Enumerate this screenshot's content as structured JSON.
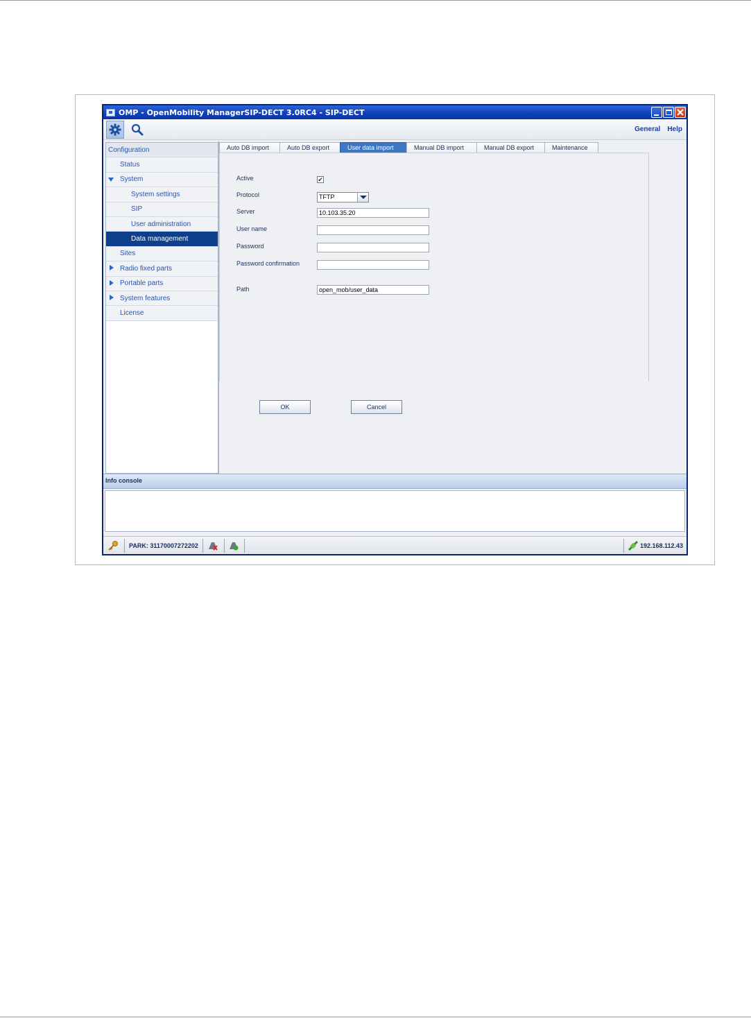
{
  "window": {
    "title": "OMP - OpenMobility ManagerSIP-DECT 3.0RC4 - SIP-DECT",
    "controls": [
      "minimize",
      "maximize",
      "close"
    ]
  },
  "toolbar": {
    "buttons": [
      "gear-icon",
      "search-icon"
    ],
    "links": {
      "general": "General",
      "help": "Help"
    }
  },
  "sidebar": {
    "items": [
      {
        "label": "Configuration",
        "level": 0,
        "expander": "none"
      },
      {
        "label": "Status",
        "level": 1,
        "expander": "none"
      },
      {
        "label": "System",
        "level": 1,
        "expander": "expanded"
      },
      {
        "label": "System settings",
        "level": 2,
        "expander": "none"
      },
      {
        "label": "SIP",
        "level": 2,
        "expander": "none"
      },
      {
        "label": "User administration",
        "level": 2,
        "expander": "none"
      },
      {
        "label": "Data management",
        "level": 2,
        "expander": "none",
        "selected": true
      },
      {
        "label": "Sites",
        "level": 1,
        "expander": "none"
      },
      {
        "label": "Radio fixed parts",
        "level": 1,
        "expander": "collapsed"
      },
      {
        "label": "Portable parts",
        "level": 1,
        "expander": "collapsed"
      },
      {
        "label": "System features",
        "level": 1,
        "expander": "collapsed"
      },
      {
        "label": "License",
        "level": 1,
        "expander": "none"
      }
    ]
  },
  "tabs": [
    {
      "label": "Auto DB import"
    },
    {
      "label": "Auto DB export"
    },
    {
      "label": "User data import",
      "active": true
    },
    {
      "label": "Manual DB import"
    },
    {
      "label": "Manual DB export"
    },
    {
      "label": "Maintenance"
    }
  ],
  "form": {
    "active": {
      "label": "Active",
      "checked": true,
      "mark": "✔"
    },
    "protocol": {
      "label": "Protocol",
      "value": "TFTP"
    },
    "server": {
      "label": "Server",
      "value": "10.103.35.20"
    },
    "user_name": {
      "label": "User name",
      "value": ""
    },
    "password": {
      "label": "Password",
      "value": ""
    },
    "password_confirmation": {
      "label": "Password confirmation",
      "value": ""
    },
    "path": {
      "label": "Path",
      "value": "open_mob/user_data"
    }
  },
  "buttons": {
    "ok": "OK",
    "cancel": "Cancel"
  },
  "console": {
    "title": "Info console",
    "content": ""
  },
  "statusbar": {
    "park": "PARK: 31170007272202",
    "ip": "192.168.112.43"
  },
  "colors": {
    "title_bar": "#0f3fb8",
    "selected_nav": "#0e3f8d",
    "active_tab": "#3c78c4",
    "nav_text": "#2955a8",
    "accent": "#2b64c6"
  }
}
